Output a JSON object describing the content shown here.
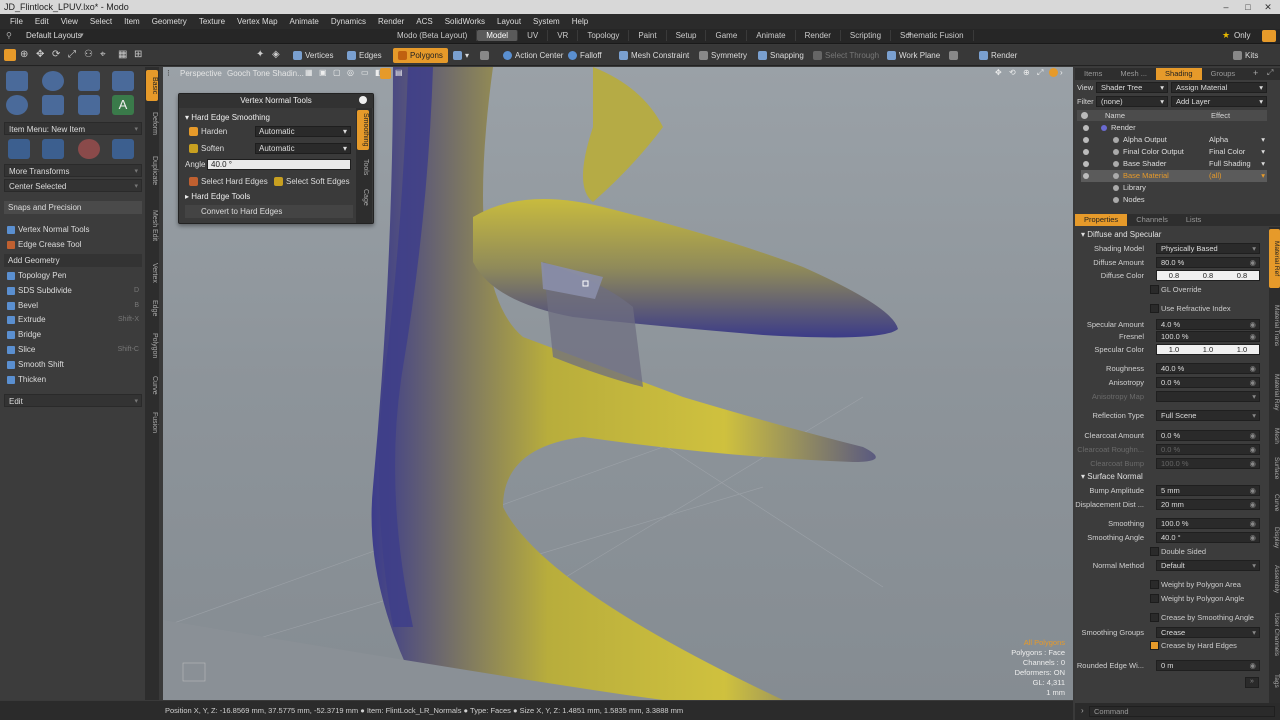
{
  "window": {
    "title": "JD_Flintlock_LPUV.lxo* - Modo"
  },
  "menubar": [
    "File",
    "Edit",
    "View",
    "Select",
    "Item",
    "Geometry",
    "Texture",
    "Vertex Map",
    "Animate",
    "Dynamics",
    "Render",
    "ACS",
    "SolidWorks",
    "Layout",
    "System",
    "Help"
  ],
  "layout": {
    "default": "Default Layouts",
    "tabs": [
      "Modo (Beta Layout)",
      "Model",
      "UV",
      "VR",
      "Topology",
      "Paint",
      "Setup",
      "Game",
      "Animate",
      "Render",
      "Scripting",
      "Schematic Fusion"
    ],
    "active_tab": "Model",
    "only": "Only"
  },
  "toolbar": {
    "vertices": "Vertices",
    "edges": "Edges",
    "polygons": "Polygons",
    "action_center": "Action Center",
    "falloff": "Falloff",
    "mesh_constraint": "Mesh Constraint",
    "symmetry": "Symmetry",
    "snapping": "Snapping",
    "select_through": "Select Through",
    "work_plane": "Work Plane",
    "render": "Render",
    "kits": "Kits"
  },
  "left": {
    "item_menu": "Item Menu: New Item",
    "more_transforms": "More Transforms",
    "center_selected": "Center Selected",
    "snaps": "Snaps and Precision",
    "vertex_normal_tools": "Vertex Normal Tools",
    "edge_crease": "Edge Crease Tool",
    "add_geometry": "Add Geometry",
    "tools": [
      {
        "label": "Topology Pen",
        "shortcut": ""
      },
      {
        "label": "SDS Subdivide",
        "shortcut": "D"
      },
      {
        "label": "Bevel",
        "shortcut": "B"
      },
      {
        "label": "Extrude",
        "shortcut": "Shift-X"
      },
      {
        "label": "Bridge",
        "shortcut": ""
      },
      {
        "label": "Slice",
        "shortcut": "Shift-C"
      },
      {
        "label": "Smooth Shift",
        "shortcut": ""
      },
      {
        "label": "Thicken",
        "shortcut": ""
      }
    ],
    "edit": "Edit",
    "vtabs": [
      "Basic",
      "Deform",
      "Duplicate",
      "Mesh Edit",
      "Vertex",
      "Edge",
      "Polygon",
      "Curve",
      "Fusion"
    ]
  },
  "viewport": {
    "view": "Perspective",
    "shading": "Gooch Tone Shadin...",
    "stats": [
      "All Polygons",
      "Polygons : Face",
      "Channels : 0",
      "Deformers: ON",
      "GL: 4,311",
      "1 mm"
    ]
  },
  "vnt": {
    "title": "Vertex Normal Tools",
    "section1": "Hard Edge Smoothing",
    "harden": "Harden",
    "harden_val": "Automatic",
    "soften": "Soften",
    "soften_val": "Automatic",
    "angle_label": "Angle",
    "angle": "40.0 °",
    "select_hard": "Select Hard Edges",
    "select_soft": "Select Soft Edges",
    "section2": "Hard Edge Tools",
    "convert": "Convert to Hard Edges",
    "vtabs": [
      "Smoothing",
      "Tools",
      "Cage"
    ]
  },
  "status": {
    "text": "Position X, Y, Z:  -16.8569 mm, 37.5775 mm, -52.3719 mm  ● Item: FlintLock_LR_Normals ● Type: Faces ● Size X, Y, Z:  1.4851 mm, 1.5835 mm, 3.3888 mm"
  },
  "right": {
    "tabs": [
      "Items",
      "Mesh ...",
      "Shading",
      "Groups"
    ],
    "active_tab": "Shading",
    "view_label": "View",
    "view_val": "Shader Tree",
    "assign": "Assign Material",
    "filter_label": "Filter",
    "filter_val": "(none)",
    "add_layer": "Add Layer",
    "col_name": "Name",
    "col_effect": "Effect",
    "tree": [
      {
        "name": "Render",
        "effect": ""
      },
      {
        "name": "Alpha Output",
        "effect": "Alpha"
      },
      {
        "name": "Final Color Output",
        "effect": "Final Color"
      },
      {
        "name": "Base Shader",
        "effect": "Full Shading"
      },
      {
        "name": "Base Material",
        "effect": "(all)"
      },
      {
        "name": "Library",
        "effect": ""
      },
      {
        "name": "Nodes",
        "effect": ""
      }
    ],
    "prop_tabs": [
      "Properties",
      "Channels",
      "Lists"
    ],
    "diffuse_section": "Diffuse and Specular",
    "shading_model": "Physically Based",
    "diffuse_amount": "80.0 %",
    "diffuse_color": [
      "0.8",
      "0.8",
      "0.8"
    ],
    "gl_override": "GL Override",
    "refractive": "Use Refractive Index",
    "specular_amount": "4.0 %",
    "fresnel": "100.0 %",
    "specular_color": [
      "1.0",
      "1.0",
      "1.0"
    ],
    "roughness": "40.0 %",
    "anisotropy": "0.0 %",
    "reflection_type": "Full Scene",
    "clearcoat_amount": "0.0 %",
    "clearcoat_rough": "0.0 %",
    "clearcoat_bump": "100.0 %",
    "surface_section": "Surface Normal",
    "bump_amp": "5 mm",
    "displacement": "20 mm",
    "smoothing": "100.0 %",
    "smoothing_angle": "40.0 °",
    "double_sided": "Double Sided",
    "normal_method": "Default",
    "weight_area": "Weight by Polygon Area",
    "weight_angle": "Weight by Polygon Angle",
    "crease_angle": "Crease by Smoothing Angle",
    "smoothing_groups": "Crease",
    "crease_hard": "Crease by Hard Edges",
    "rounded": "0 m",
    "labels": {
      "shading_model": "Shading Model",
      "diffuse_amount": "Diffuse Amount",
      "diffuse_color": "Diffuse Color",
      "specular_amount": "Specular Amount",
      "fresnel": "Fresnel",
      "specular_color": "Specular Color",
      "roughness": "Roughness",
      "anisotropy": "Anisotropy",
      "anisotropy_map": "Anisotropy Map",
      "reflection_type": "Reflection Type",
      "clearcoat_amount": "Clearcoat Amount",
      "clearcoat_rough": "Clearcoat Roughn...",
      "clearcoat_bump": "Clearcoat Bump",
      "bump_amp": "Bump Amplitude",
      "displacement": "Displacement Dist ...",
      "smoothing": "Smoothing",
      "smoothing_angle": "Smoothing Angle",
      "normal_method": "Normal Method",
      "smoothing_groups": "Smoothing Groups",
      "rounded": "Rounded Edge Wi..."
    },
    "vtabs": [
      "Material Ref",
      "Material Trans",
      "Material Ray",
      "Mesh",
      "Surface",
      "Curve",
      "Display",
      "Assembly",
      "User Channels",
      "Tags"
    ],
    "command": "Command"
  },
  "colors": {
    "accent": "#e69a2a",
    "mesh_yellow": "#c8b838",
    "mesh_blue": "#3a3a8a"
  }
}
